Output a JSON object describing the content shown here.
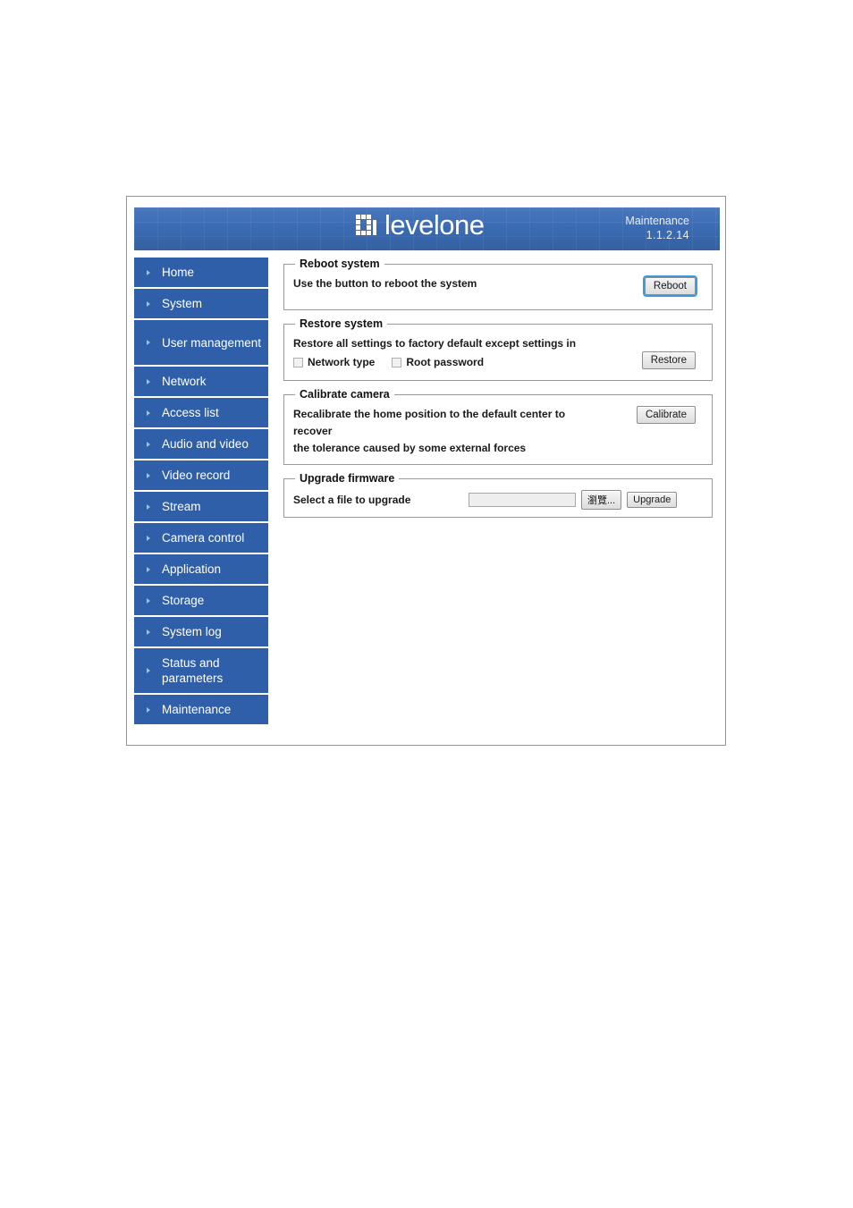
{
  "header": {
    "logo_text": "levelone",
    "logo_icon": "levelone-grid-logo",
    "page_title": "Maintenance",
    "version": "1.1.2.14",
    "bg_color": "#3a6bb5"
  },
  "sidebar": {
    "bg_color": "#2f5fa8",
    "items": [
      {
        "label": "Home",
        "name": "home"
      },
      {
        "label": "System",
        "name": "system"
      },
      {
        "label": "User management",
        "name": "user-management",
        "two_line": true
      },
      {
        "label": "Network",
        "name": "network"
      },
      {
        "label": "Access list",
        "name": "access-list"
      },
      {
        "label": "Audio and video",
        "name": "audio-and-video"
      },
      {
        "label": "Video record",
        "name": "video-record"
      },
      {
        "label": "Stream",
        "name": "stream"
      },
      {
        "label": "Camera control",
        "name": "camera-control"
      },
      {
        "label": "Application",
        "name": "application"
      },
      {
        "label": "Storage",
        "name": "storage"
      },
      {
        "label": "System log",
        "name": "system-log"
      },
      {
        "label": "Status and parameters",
        "name": "status-and-parameters",
        "two_line": true
      },
      {
        "label": "Maintenance",
        "name": "maintenance"
      }
    ]
  },
  "main": {
    "reboot": {
      "legend": "Reboot system",
      "description": "Use the button to reboot the system",
      "button_label": "Reboot"
    },
    "restore": {
      "legend": "Restore system",
      "description": "Restore all settings to factory default except settings in",
      "checkbox_network_label": "Network type",
      "checkbox_root_label": "Root password",
      "button_label": "Restore"
    },
    "calibrate": {
      "legend": "Calibrate camera",
      "description_line1": "Recalibrate the home position to the default center to recover",
      "description_line2": "the tolerance caused by some external forces",
      "button_label": "Calibrate"
    },
    "upgrade": {
      "legend": "Upgrade firmware",
      "field_label": "Select a file to upgrade",
      "file_value": "",
      "browse_label": "瀏覽...",
      "button_label": "Upgrade"
    }
  }
}
